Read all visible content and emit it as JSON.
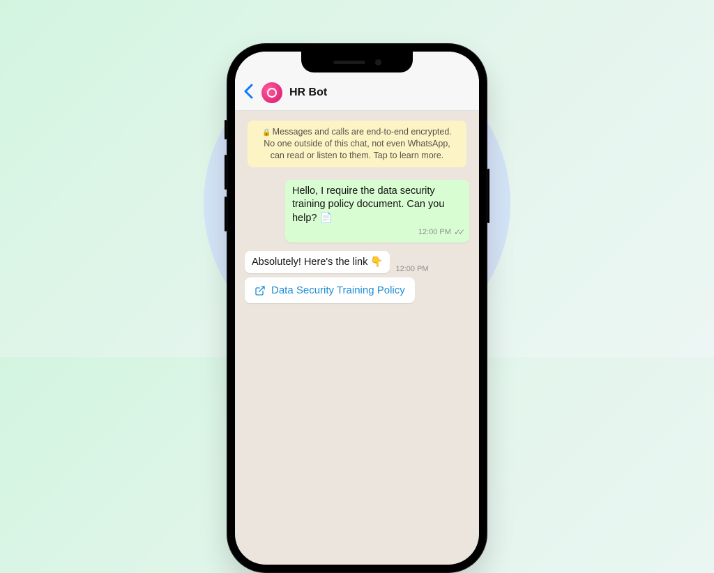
{
  "header": {
    "contact_name": "HR Bot"
  },
  "encryption": {
    "text": "Messages and calls are end-to-end encrypted. No one outside of this chat, not even WhatsApp, can read or listen to them. Tap to learn more."
  },
  "messages": {
    "outgoing": {
      "text": "Hello, I require the data security training policy document. Can you help? 📄",
      "time": "12:00 PM"
    },
    "incoming": {
      "text": "Absolutely! Here's the link 👇",
      "time": "12:00 PM",
      "link_label": "Data Security Training Policy"
    }
  }
}
